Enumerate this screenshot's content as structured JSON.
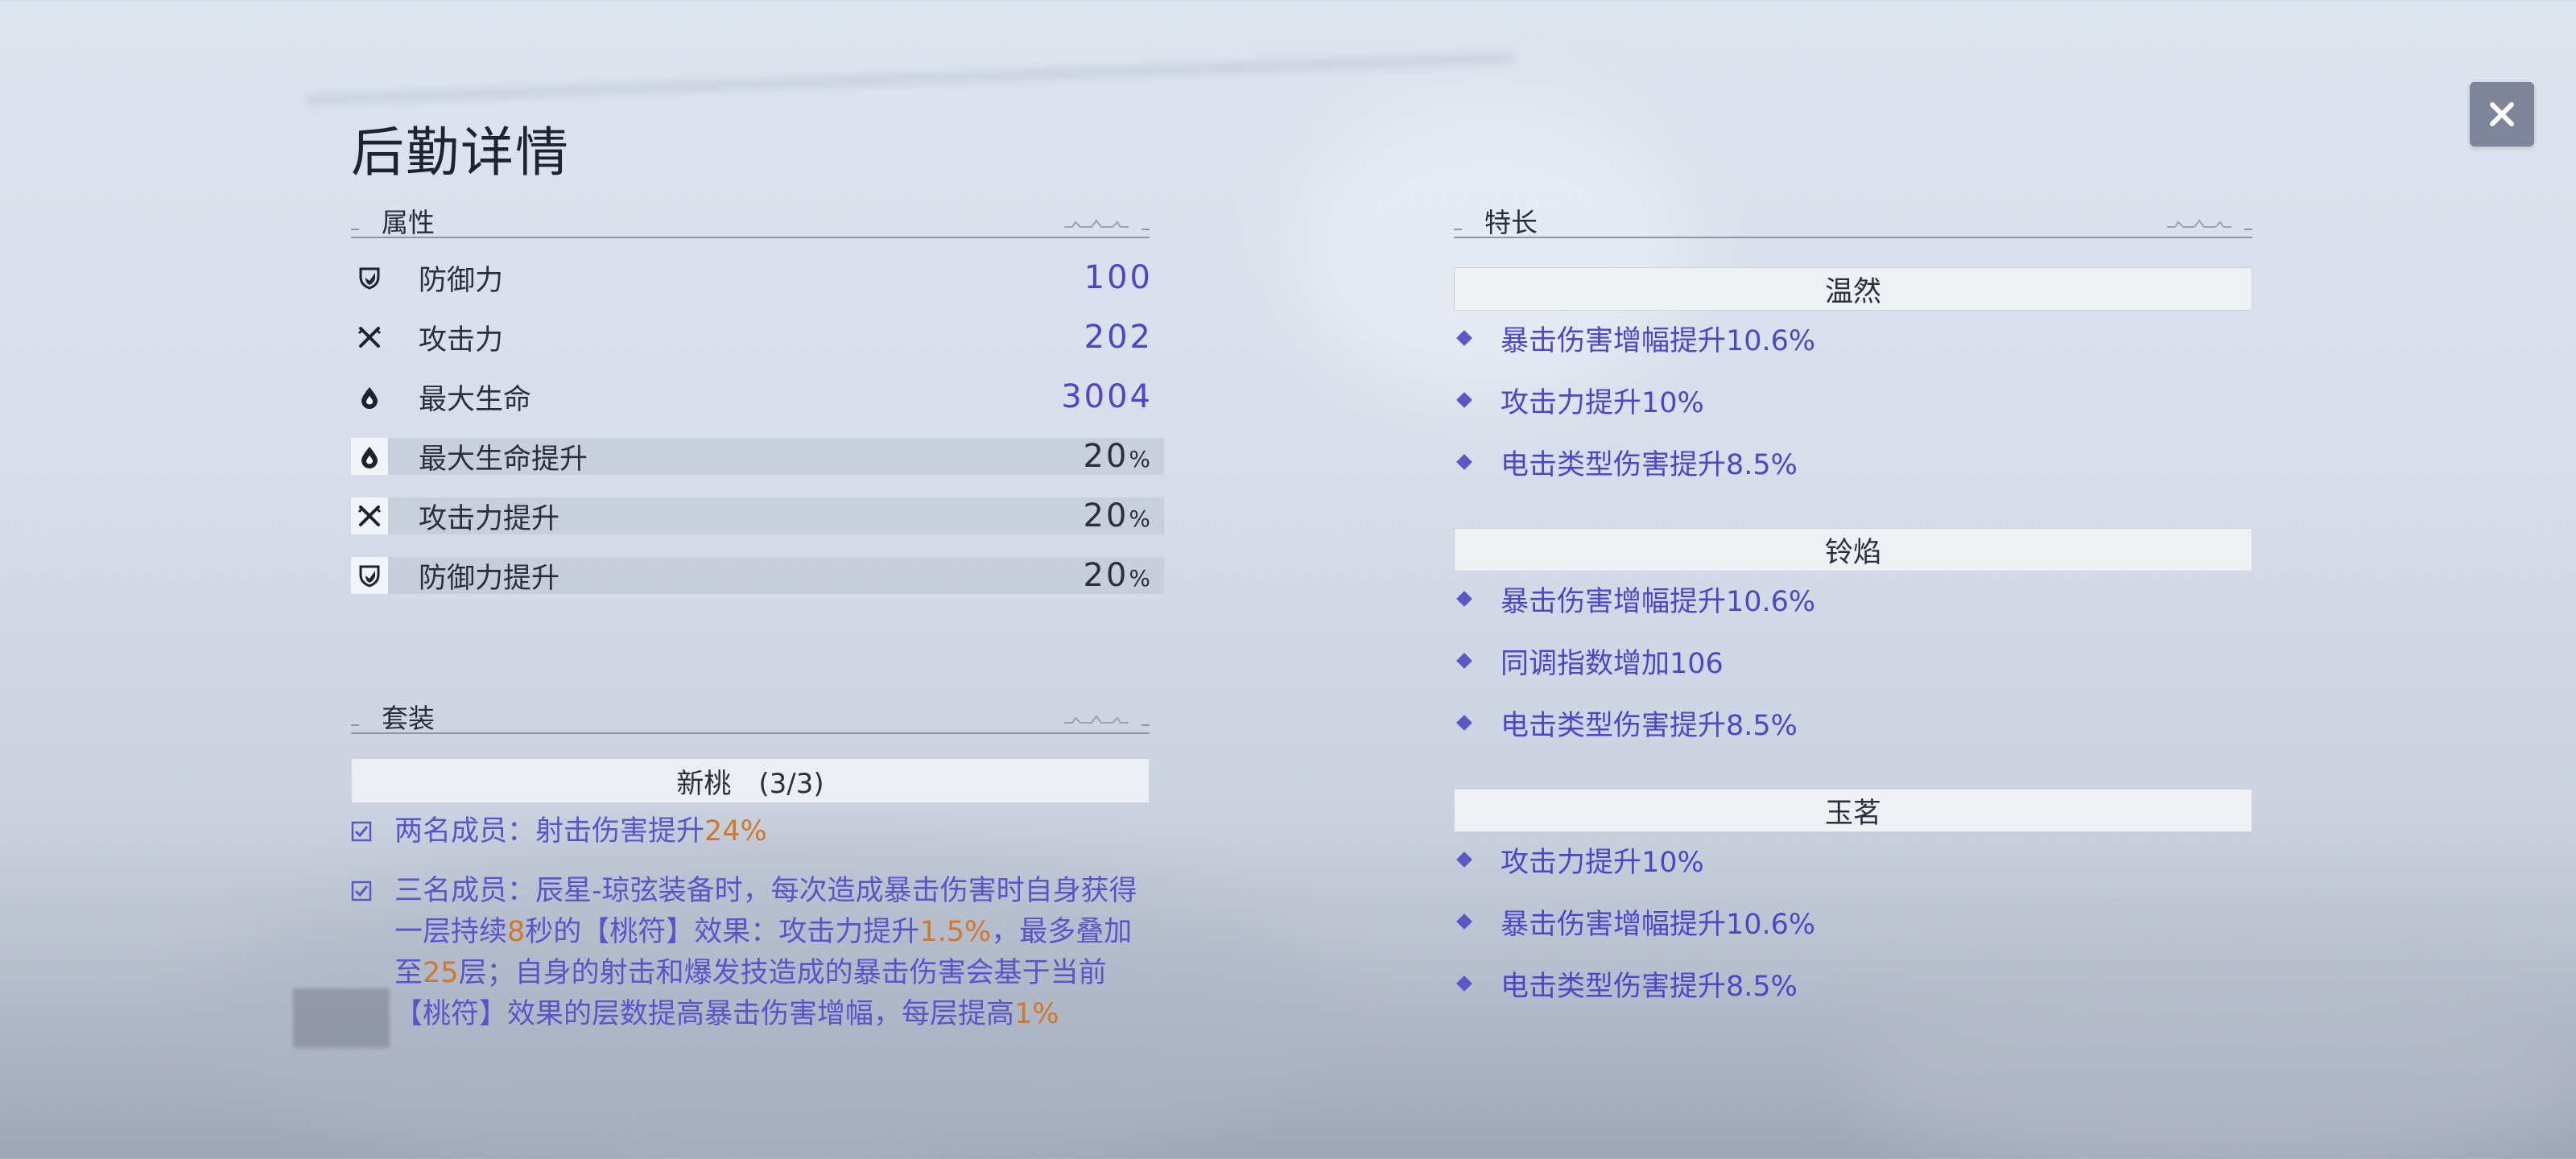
{
  "title": "后勤详情",
  "attributes": {
    "section_label": "属性",
    "rows": [
      {
        "name": "防御力",
        "value": "100",
        "icon": "shield-icon"
      },
      {
        "name": "攻击力",
        "value": "202",
        "icon": "crossed-swords-icon"
      },
      {
        "name": "最大生命",
        "value": "3004",
        "icon": "drop-icon"
      },
      {
        "name": "最大生命提升",
        "value": "20",
        "unit": "%",
        "icon": "drop-icon"
      },
      {
        "name": "攻击力提升",
        "value": "20",
        "unit": "%",
        "icon": "crossed-swords-icon"
      },
      {
        "name": "防御力提升",
        "value": "20",
        "unit": "%",
        "icon": "shield-icon"
      }
    ]
  },
  "set": {
    "section_label": "套装",
    "name": "新桃　(3/3)",
    "effects": [
      {
        "parts": [
          {
            "text": "两名成员：射击伤害提升",
            "hl": false
          },
          {
            "text": "24%",
            "hl": true
          }
        ]
      },
      {
        "parts": [
          {
            "text": "三名成员：辰星-琼弦装备时，每次造成暴击伤害时自身获得一层持续",
            "hl": false
          },
          {
            "text": "8",
            "hl": true
          },
          {
            "text": "秒的【桃符】效果：攻击力提升",
            "hl": false
          },
          {
            "text": "1.5%",
            "hl": true
          },
          {
            "text": "，最多叠加至",
            "hl": false
          },
          {
            "text": "25",
            "hl": true
          },
          {
            "text": "层；自身的射击和爆发技造成的暴击伤害会基于当前【桃符】效果的层数提高暴击伤害增幅，每层提高",
            "hl": false
          },
          {
            "text": "1%",
            "hl": true
          }
        ]
      }
    ]
  },
  "specialties": {
    "section_label": "特长",
    "groups": [
      {
        "name": "温然",
        "items": [
          "暴击伤害增幅提升10.6%",
          "攻击力提升10%",
          "电击类型伤害提升8.5%"
        ]
      },
      {
        "name": "铃焰",
        "items": [
          "暴击伤害增幅提升10.6%",
          "同调指数增加106",
          "电击类型伤害提升8.5%"
        ]
      },
      {
        "name": "玉茗",
        "items": [
          "攻击力提升10%",
          "暴击伤害增幅提升10.6%",
          "电击类型伤害提升8.5%"
        ]
      }
    ]
  },
  "colors": {
    "value_accent": "#4d47c8",
    "highlight_orange": "#d0782a",
    "close_button_bg": "#7e8598"
  },
  "icons": {
    "close": "close-icon",
    "check": "checkbox-checked-icon",
    "bullet": "diamond-bullet-icon"
  }
}
